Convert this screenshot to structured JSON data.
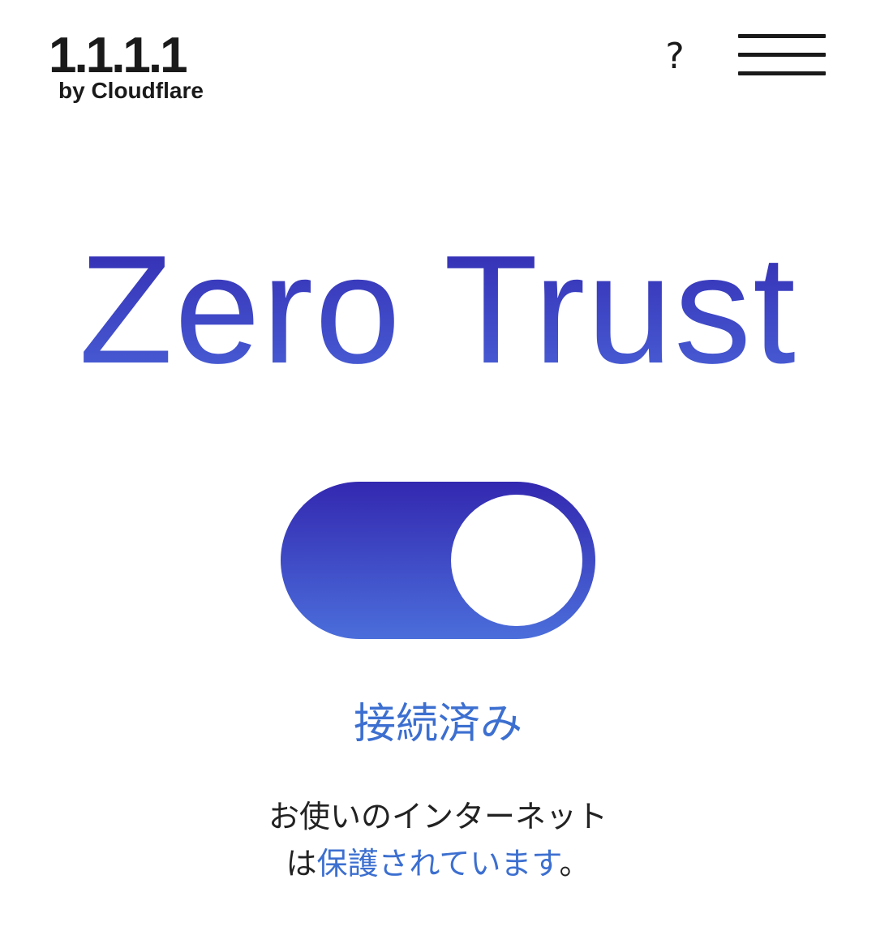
{
  "header": {
    "logo_main": "1.1.1.1",
    "logo_sub": "by Cloudflare",
    "help_label": "?",
    "menu_icon": "hamburger-menu-icon"
  },
  "hero": {
    "title": "Zero Trust"
  },
  "toggle": {
    "state": "on"
  },
  "status": {
    "label": "接続済み"
  },
  "description": {
    "line1": "お使いのインターネット",
    "line2_prefix": "は",
    "line2_highlight": "保護されています",
    "line2_suffix": "。"
  },
  "colors": {
    "accent": "#3c6fd0",
    "gradient_top": "#3229b0",
    "gradient_bottom": "#4b6edb",
    "text": "#1a1a1a"
  }
}
